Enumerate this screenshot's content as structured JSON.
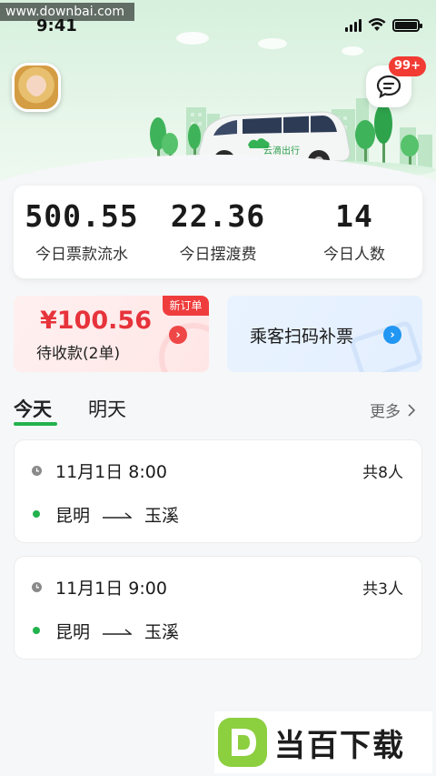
{
  "status_bar": {
    "time": "9:41"
  },
  "watermark": "www.downbai.com",
  "header": {
    "message_badge": "99+",
    "car_brand": "云滴出行"
  },
  "stats": [
    {
      "value": "500.55",
      "label": "今日票款流水"
    },
    {
      "value": "22.36",
      "label": "今日摆渡费"
    },
    {
      "value": "14",
      "label": "今日人数"
    }
  ],
  "pending_card": {
    "amount": "¥100.56",
    "label": "待收款(2单)",
    "tag": "新订单"
  },
  "scan_card": {
    "label": "乘客扫码补票"
  },
  "tabs": [
    {
      "label": "今天",
      "active": true
    },
    {
      "label": "明天",
      "active": false
    }
  ],
  "more_label": "更多",
  "trips": [
    {
      "datetime": "11月1日  8:00",
      "count": "共8人",
      "from": "昆明",
      "to": "玉溪"
    },
    {
      "datetime": "11月1日  9:00",
      "count": "共3人",
      "from": "昆明",
      "to": "玉溪"
    }
  ],
  "download_logo": {
    "text": "当百下载"
  },
  "colors": {
    "accent_green": "#22b24c",
    "danger_red": "#e7333b",
    "info_blue": "#2196f3"
  }
}
